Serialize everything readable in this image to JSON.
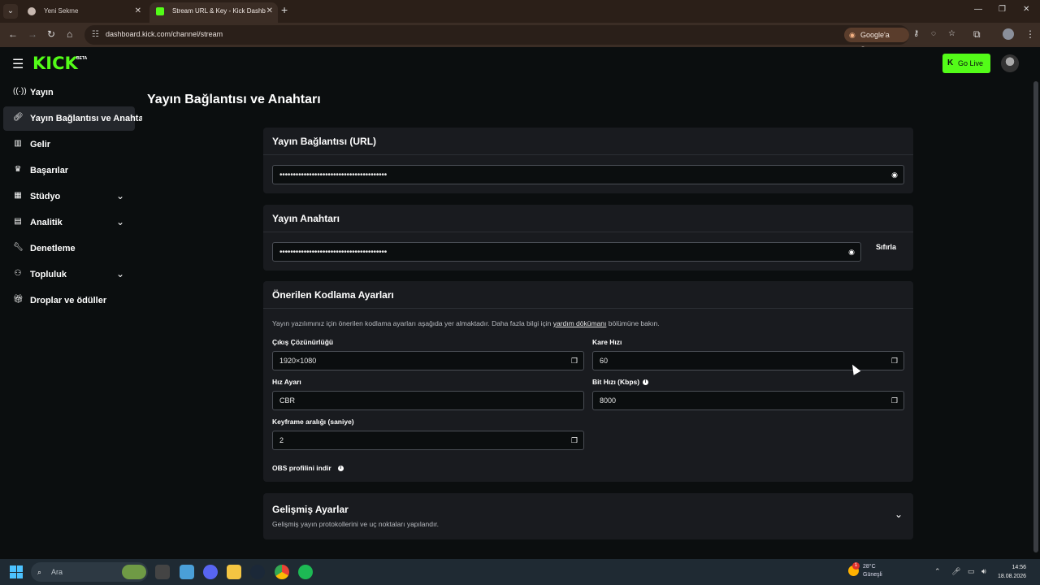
{
  "browser": {
    "tabs": [
      {
        "label": "Yeni Sekme"
      },
      {
        "label": "Stream URL & Key - Kick Dashb"
      }
    ],
    "url": "dashboard.kick.com/channel/stream",
    "ask_google": "Google'a Sor"
  },
  "header": {
    "logo": "KICK",
    "beta": "BETA",
    "go_live": "Go Live"
  },
  "sidebar": {
    "items": [
      {
        "label": "Yayın",
        "icon": "broadcast-icon"
      },
      {
        "label": "Yayın Bağlantısı ve Anahtarı",
        "icon": "link-icon",
        "active": true
      },
      {
        "label": "Gelir",
        "icon": "chart-icon"
      },
      {
        "label": "Başarılar",
        "icon": "trophy-icon"
      },
      {
        "label": "Stüdyo",
        "icon": "studio-icon",
        "expandable": true
      },
      {
        "label": "Analitik",
        "icon": "analytics-icon",
        "expandable": true
      },
      {
        "label": "Denetleme",
        "icon": "wrench-icon"
      },
      {
        "label": "Topluluk",
        "icon": "community-icon",
        "expandable": true
      },
      {
        "label": "Droplar ve ödüller",
        "icon": "gift-icon"
      }
    ]
  },
  "main": {
    "title": "Yayın Bağlantısı ve Anahtarı",
    "stream_url": {
      "heading": "Yayın Bağlantısı (URL)",
      "value": "••••••••••••••••••••••••••••••••••••••••"
    },
    "stream_key": {
      "heading": "Yayın Anahtarı",
      "value": "••••••••••••••••••••••••••••••••••••••••",
      "reset_label": "Sıfırla"
    },
    "encoding": {
      "heading": "Önerilen Kodlama Ayarları",
      "desc_pre": "Yayın yazılımınız için önerilen kodlama ayarları aşağıda yer almaktadır. Daha fazla bilgi için",
      "desc_link": "yardım dökümanı",
      "desc_post": "bölümüne bakın.",
      "resolution_label": "Çıkış Çözünürlüğü",
      "resolution_value": "1920×1080",
      "framerate_label": "Kare Hızı",
      "framerate_value": "60",
      "rate_control_label": "Hız Ayarı",
      "rate_control_value": "CBR",
      "bitrate_label": "Bit Hızı (Kbps)",
      "bitrate_value": "8000",
      "keyframe_label": "Keyframe aralığı (saniye)",
      "keyframe_value": "2",
      "obs_label": "OBS profilini indir"
    },
    "advanced": {
      "heading": "Gelişmiş Ayarlar",
      "subtitle": "Gelişmiş yayın protokollerini ve uç noktaları yapılandır."
    }
  },
  "taskbar": {
    "search_placeholder": "Ara",
    "weather_temp": "28°C",
    "weather_desc": "Güneşli",
    "weather_badge": "1",
    "time": "14:56",
    "date": "18.08.2026"
  },
  "colors": {
    "accent": "#53fc18",
    "card": "#191b1f",
    "background": "#0b0e0f"
  }
}
